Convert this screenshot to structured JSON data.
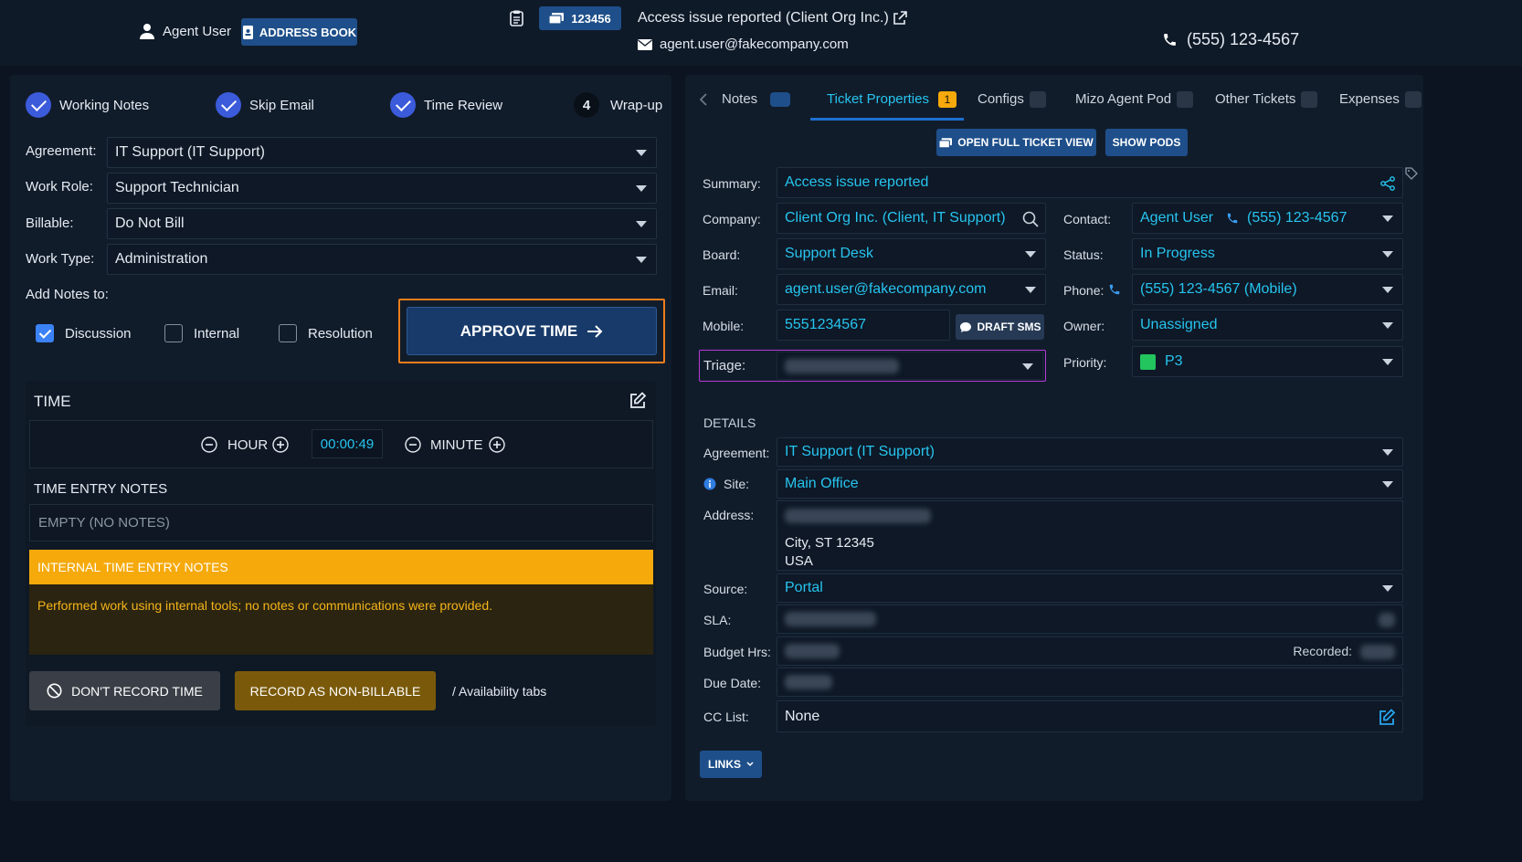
{
  "header": {
    "user_name": "Agent User",
    "address_book_label": "ADDRESS BOOK",
    "ticket_number": "123456",
    "ticket_title": "Access issue reported (Client Org Inc.)",
    "email": "agent.user@fakecompany.com",
    "phone": "(555) 123-4567"
  },
  "steps": [
    {
      "label": "Working Notes",
      "done": true
    },
    {
      "label": "Skip Email",
      "done": true
    },
    {
      "label": "Time Review",
      "done": true
    },
    {
      "label": "Wrap-up",
      "number": "4"
    }
  ],
  "form": {
    "agreement_label": "Agreement:",
    "agreement_value": "IT Support (IT Support)",
    "work_role_label": "Work Role:",
    "work_role_value": "Support Technician",
    "billable_label": "Billable:",
    "billable_value": "Do Not Bill",
    "work_type_label": "Work Type:",
    "work_type_value": "Administration",
    "add_notes_label": "Add Notes to:",
    "discussion_label": "Discussion",
    "internal_label": "Internal",
    "resolution_label": "Resolution",
    "approve_label": "APPROVE TIME"
  },
  "time": {
    "title": "TIME",
    "hour_label": "HOUR",
    "minute_label": "MINUTE",
    "value": "00:00:49",
    "entry_notes_title": "TIME ENTRY NOTES",
    "entry_notes_placeholder": "EMPTY (NO NOTES)",
    "internal_notes_title": "INTERNAL TIME ENTRY NOTES",
    "internal_notes_text": "Performed work using internal tools; no notes or communications were provided.",
    "dont_record_label": "DON'T RECORD TIME",
    "non_billable_label": "RECORD AS NON-BILLABLE",
    "availability_text": "/ Availability tabs"
  },
  "tabs": {
    "notes": "Notes",
    "ticket_properties": "Ticket Properties",
    "ticket_properties_badge": "1",
    "configs": "Configs",
    "pod": "Mizo Agent Pod",
    "other_tickets": "Other Tickets",
    "expenses": "Expenses"
  },
  "ticket": {
    "open_full_label": "OPEN FULL TICKET VIEW",
    "show_pods_label": "SHOW PODS",
    "summary_label": "Summary:",
    "summary_value": "Access issue reported",
    "company_label": "Company:",
    "company_value": "Client Org Inc. (Client, IT Support)",
    "board_label": "Board:",
    "board_value": "Support Desk",
    "email_label": "Email:",
    "email_value": "agent.user@fakecompany.com",
    "mobile_label": "Mobile:",
    "mobile_value": "5551234567",
    "draft_sms_label": "DRAFT SMS",
    "triage_label": "Triage:",
    "contact_label": "Contact:",
    "contact_name": "Agent User",
    "contact_phone": "(555) 123-4567",
    "status_label": "Status:",
    "status_value": "In Progress",
    "phone_label": "Phone:",
    "phone_value": "(555) 123-4567 (Mobile)",
    "owner_label": "Owner:",
    "owner_value": "Unassigned",
    "priority_label": "Priority:",
    "priority_value": "P3",
    "priority_color": "#22c55e"
  },
  "details": {
    "title": "DETAILS",
    "agreement_label": "Agreement:",
    "agreement_value": "IT Support (IT Support)",
    "site_label": "Site:",
    "site_value": "Main Office",
    "address_label": "Address:",
    "address_line2": "City, ST 12345",
    "address_line3": "USA",
    "source_label": "Source:",
    "source_value": "Portal",
    "sla_label": "SLA:",
    "budget_label": "Budget Hrs:",
    "recorded_label": "Recorded:",
    "due_label": "Due Date:",
    "cc_label": "CC List:",
    "cc_value": "None",
    "links_label": "LINKS"
  },
  "colors": {
    "accent": "#27c4ef",
    "approve_outline": "#f07d1a",
    "warning": "#f5a90a"
  }
}
